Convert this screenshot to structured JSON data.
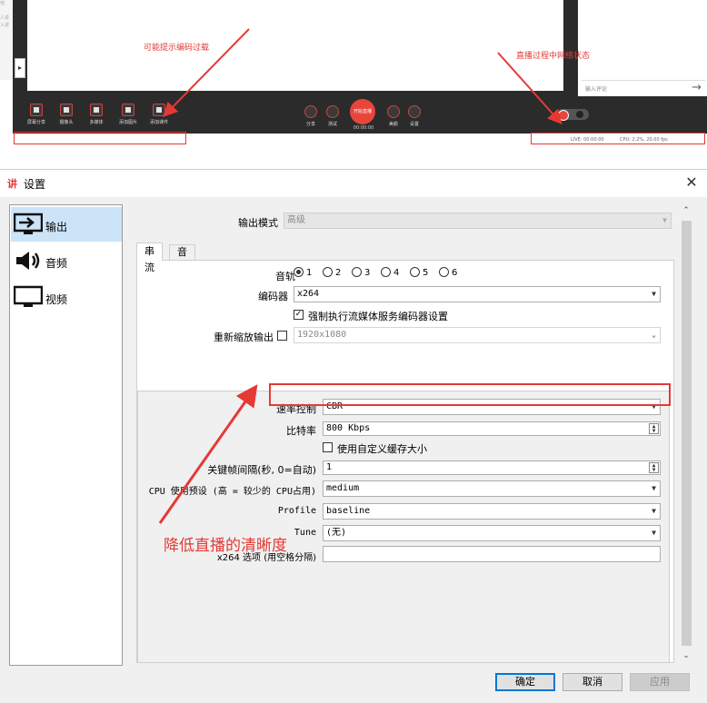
{
  "top_app": {
    "left_edge_text": "他\n\n人讲\n入讲",
    "left_expand": "▸",
    "comment_placeholder": "输入评论",
    "comment_send": "→",
    "tools": [
      {
        "label": "屏幕分享",
        "icon": "screen-share-icon"
      },
      {
        "label": "摄像头",
        "icon": "camera-icon"
      },
      {
        "label": "多媒体",
        "icon": "media-icon"
      },
      {
        "label": "添加图片",
        "icon": "image-icon"
      },
      {
        "label": "添加课件",
        "icon": "folder-icon"
      }
    ],
    "controls": [
      {
        "label": "分享",
        "icon": "share-icon"
      },
      {
        "label": "测试",
        "icon": "test-icon"
      },
      {
        "label": "美颜",
        "icon": "beauty-icon"
      },
      {
        "label": "设置",
        "icon": "settings-icon"
      }
    ],
    "start_live": "开始直播",
    "live_timer": "00:00:00",
    "status_live": "LIVE: 00:00:00",
    "status_cpu": "CPU: 2.2%, 20.00 fps",
    "annotation_encode": "可能提示编码过载",
    "annotation_live": "直播过程中网络状态"
  },
  "dialog": {
    "logo": "讲",
    "title": "设置",
    "close": "✕",
    "sidebar": [
      {
        "label": "输出",
        "icon": "output-monitor-icon",
        "selected": true
      },
      {
        "label": "音频",
        "icon": "speaker-icon",
        "selected": false
      },
      {
        "label": "视频",
        "icon": "monitor-icon",
        "selected": false
      }
    ],
    "output_mode_label": "输出模式",
    "output_mode_value": "高级",
    "tabs": [
      "串流",
      "音频"
    ],
    "audio_track_label": "音轨",
    "audio_tracks": [
      "1",
      "2",
      "3",
      "4",
      "5",
      "6"
    ],
    "encoder_label": "编码器",
    "encoder_value": "x264",
    "enforce_label": "强制执行流媒体服务编码器设置",
    "rescale_label": "重新缩放输出",
    "rescale_value": "1920x1080",
    "rate_control_label": "速率控制",
    "rate_control_value": "CBR",
    "bitrate_label": "比特率",
    "bitrate_value": "800 Kbps",
    "custom_buffer_label": "使用自定义缓存大小",
    "keyframe_label": "关键帧间隔(秒, 0=自动)",
    "keyframe_value": "1",
    "cpu_preset_label": "CPU 使用预设 (高 = 较少的 CPU占用)",
    "cpu_preset_value": "medium",
    "profile_label": "Profile",
    "profile_value": "baseline",
    "tune_label": "Tune",
    "tune_value": "(无)",
    "x264_opts_label": "x264 选项 (用空格分隔)",
    "x264_opts_value": "",
    "annotation_bitrate": "降低直播的清晰度",
    "ok": "确定",
    "cancel": "取消",
    "apply": "应用"
  },
  "colors": {
    "accent": "#e53935",
    "selection": "#cce4f7",
    "focus": "#0078d7"
  }
}
